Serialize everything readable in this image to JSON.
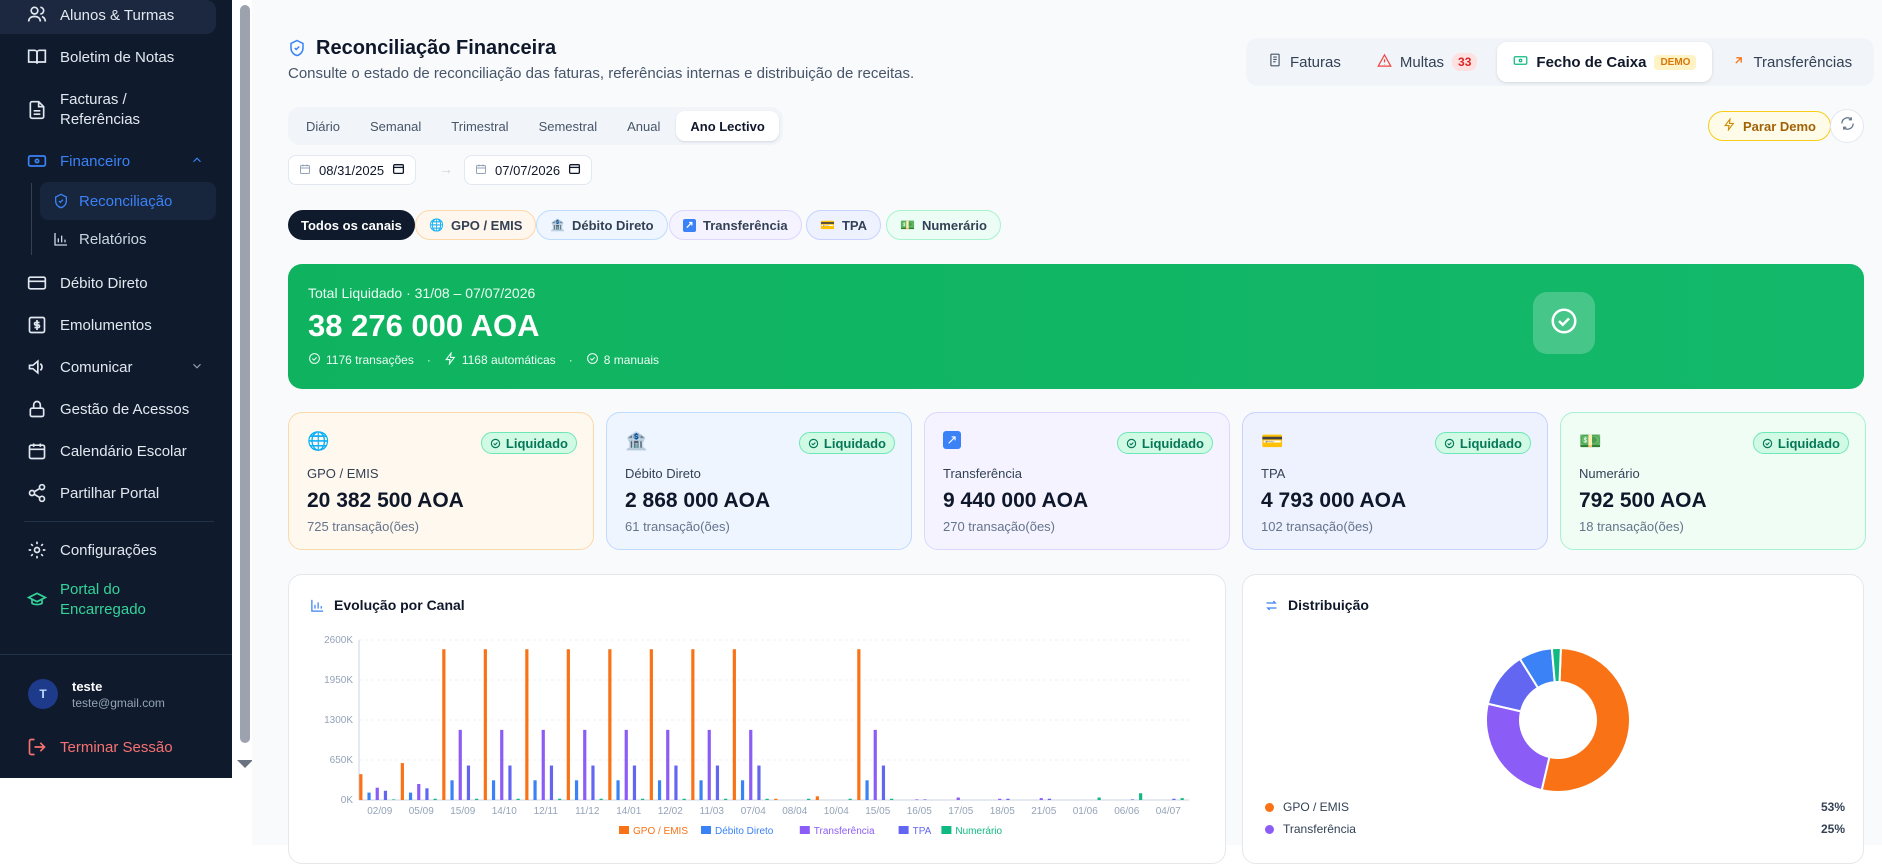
{
  "sidebar": {
    "items": [
      {
        "label": "Alunos & Turmas",
        "icon": "users-icon"
      },
      {
        "label": "Boletim de Notas",
        "icon": "book-icon"
      },
      {
        "label": "Facturas / Referências",
        "label_line1": "Facturas /",
        "label_line2": "Referências",
        "icon": "file-icon"
      },
      {
        "label": "Financeiro",
        "icon": "wallet-icon"
      },
      {
        "label": "Débito Direto",
        "icon": "card-icon"
      },
      {
        "label": "Emolumentos",
        "icon": "dollar-icon"
      },
      {
        "label": "Comunicar",
        "icon": "megaphone-icon"
      },
      {
        "label": "Gestão de Acessos",
        "icon": "lock-icon"
      },
      {
        "label": "Calendário Escolar",
        "icon": "calendar-icon"
      },
      {
        "label": "Partilhar Portal",
        "icon": "share-icon"
      },
      {
        "label": "Configurações",
        "icon": "gear-icon"
      }
    ],
    "financeiro_sub": [
      {
        "label": "Reconciliação",
        "icon": "shield-check-icon"
      },
      {
        "label": "Relatórios",
        "icon": "bar-chart-icon"
      }
    ],
    "portal": {
      "line1": "Portal do",
      "line2": "Encarregado"
    },
    "user": {
      "initial": "T",
      "name": "teste",
      "email": "teste@gmail.com"
    },
    "logout": "Terminar Sessão"
  },
  "header": {
    "title": "Reconciliação Financeira",
    "subtitle": "Consulte o estado de reconciliação das faturas, referências internas e distribuição de receitas."
  },
  "top_tabs": [
    {
      "label": "Faturas",
      "icon": "receipt-icon"
    },
    {
      "label": "Multas",
      "icon": "warning-icon",
      "badge": "33"
    },
    {
      "label": "Fecho de Caixa",
      "icon": "cash-icon",
      "tag": "DEMO"
    },
    {
      "label": "Transferências",
      "icon": "arrow-up-right-icon"
    }
  ],
  "periods": [
    "Diário",
    "Semanal",
    "Trimestral",
    "Semestral",
    "Anual",
    "Ano Lectivo"
  ],
  "selected_period": "Ano Lectivo",
  "actions": {
    "stop_demo": "Parar Demo"
  },
  "dates": {
    "from": "08/31/2025",
    "to": "07/07/2026",
    "arrow": "→"
  },
  "channels": [
    "Todos os canais",
    "GPO / EMIS",
    "Débito Direto",
    "Transferência",
    "TPA",
    "Numerário"
  ],
  "selected_channel": "Todos os canais",
  "total": {
    "label": "Total Liquidado · 31/08 – 07/07/2026",
    "amount": "38 276 000 AOA",
    "transactions": "1176 transações",
    "separator": "·",
    "automatic": "1168 automáticas",
    "manual": "8 manuais"
  },
  "stats": [
    {
      "name": "GPO / EMIS",
      "amount": "20 382 500 AOA",
      "count": "725 transação(ões)",
      "status": "Liquidado",
      "emoji": "🌐"
    },
    {
      "name": "Débito Direto",
      "amount": "2 868 000 AOA",
      "count": "61 transação(ões)",
      "status": "Liquidado",
      "emoji": "🏦"
    },
    {
      "name": "Transferência",
      "amount": "9 440 000 AOA",
      "count": "270 transação(ões)",
      "status": "Liquidado",
      "emoji": "↗"
    },
    {
      "name": "TPA",
      "amount": "4 793 000 AOA",
      "count": "102 transação(ões)",
      "status": "Liquidado",
      "emoji": "💳"
    },
    {
      "name": "Numerário",
      "amount": "792 500 AOA",
      "count": "18 transação(ões)",
      "status": "Liquidado",
      "emoji": "💵"
    }
  ],
  "colors": {
    "gpo": "#f97316",
    "debito": "#3b82f6",
    "transferencia": "#8b5cf6",
    "tpa": "#6366f1",
    "numerario": "#10b981",
    "accent": "#3b82f6",
    "success": "#10b981",
    "danger": "#ef4444"
  },
  "evolution": {
    "title": "Evolução por Canal"
  },
  "distribution": {
    "title": "Distribuição",
    "legend": [
      {
        "name": "GPO / EMIS",
        "pct": "53%"
      },
      {
        "name": "Transferência",
        "pct": "25%"
      }
    ]
  },
  "chart_data": [
    {
      "type": "bar",
      "title": "Evolução por Canal",
      "ylim": [
        0,
        2600
      ],
      "y_ticks": [
        "0K",
        "650K",
        "1300K",
        "1950K",
        "2600K"
      ],
      "x_ticks": [
        "02/09",
        "05/09",
        "15/09",
        "14/10",
        "12/11",
        "11/12",
        "14/01",
        "12/02",
        "11/03",
        "07/04",
        "08/04",
        "10/04",
        "15/05",
        "16/05",
        "17/05",
        "18/05",
        "21/05",
        "01/06",
        "06/06",
        "04/07"
      ],
      "legend_position": "bottom",
      "series": [
        {
          "name": "GPO / EMIS",
          "values": [
            420,
            600,
            2450,
            2450,
            2450,
            2450,
            2450,
            2450,
            2450,
            2450,
            20,
            60,
            2450,
            0,
            0,
            0,
            0,
            0,
            0,
            0
          ]
        },
        {
          "name": "Débito Direto",
          "values": [
            120,
            120,
            320,
            320,
            320,
            320,
            320,
            320,
            320,
            320,
            0,
            0,
            320,
            0,
            0,
            0,
            0,
            0,
            0,
            0
          ]
        },
        {
          "name": "Transferência",
          "values": [
            200,
            260,
            1140,
            1140,
            1140,
            1140,
            1140,
            1140,
            1140,
            1140,
            0,
            0,
            1140,
            10,
            40,
            20,
            30,
            0,
            0,
            0
          ]
        },
        {
          "name": "TPA",
          "values": [
            150,
            190,
            560,
            560,
            560,
            560,
            560,
            560,
            560,
            560,
            0,
            0,
            560,
            10,
            0,
            20,
            20,
            0,
            10,
            20
          ]
        },
        {
          "name": "Numerário",
          "values": [
            10,
            20,
            20,
            20,
            20,
            20,
            20,
            20,
            20,
            20,
            20,
            20,
            20,
            0,
            0,
            0,
            0,
            40,
            110,
            30
          ]
        }
      ]
    },
    {
      "type": "pie",
      "title": "Distribuição",
      "categories": [
        "GPO / EMIS",
        "Transferência",
        "TPA",
        "Débito Direto",
        "Numerário"
      ],
      "values": [
        53,
        25,
        12.5,
        7.5,
        2
      ]
    }
  ]
}
